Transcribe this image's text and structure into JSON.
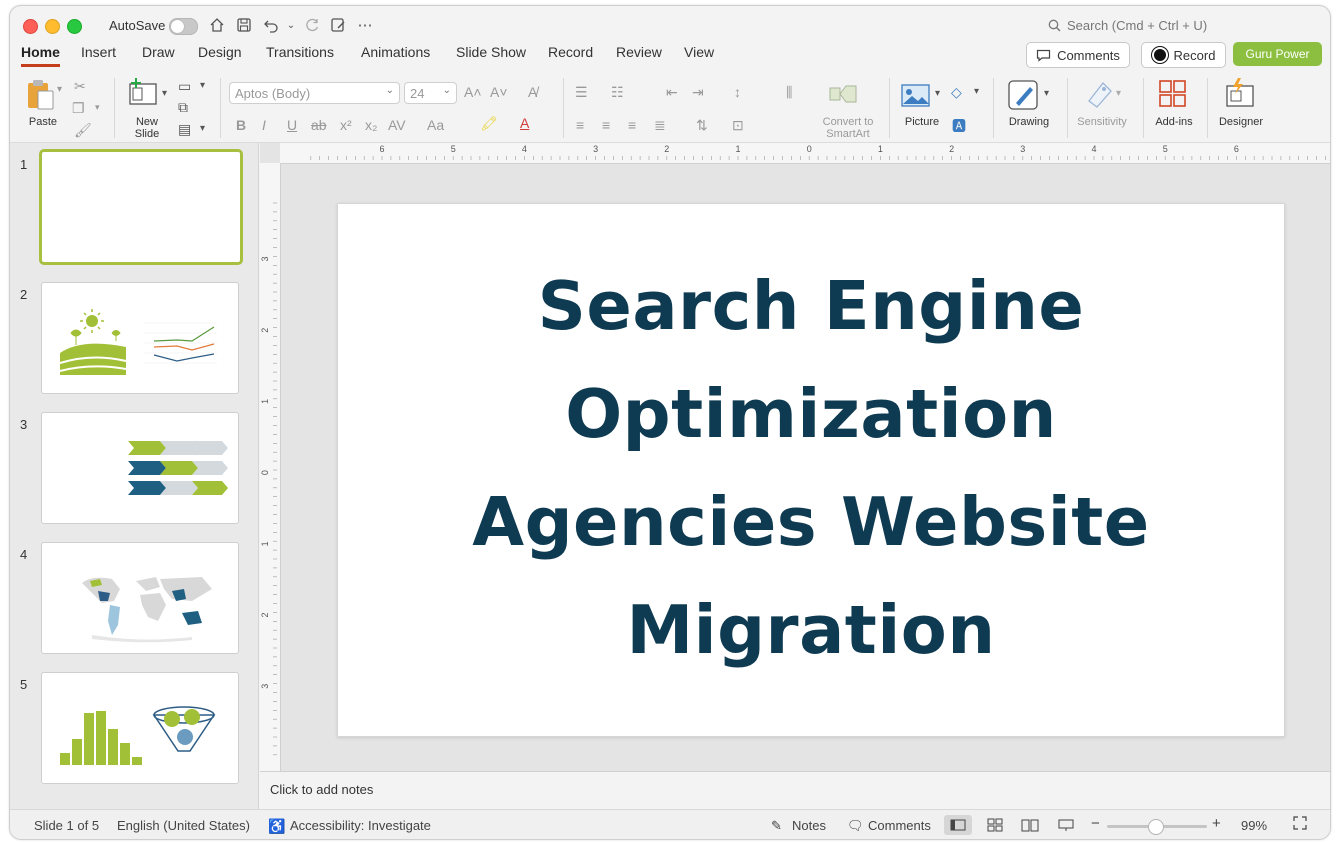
{
  "titlebar": {
    "autosave_label": "AutoSave",
    "search_placeholder": "Search (Cmd + Ctrl + U)"
  },
  "tabs": [
    "Home",
    "Insert",
    "Draw",
    "Design",
    "Transitions",
    "Animations",
    "Slide Show",
    "Record",
    "Review",
    "View"
  ],
  "header_buttons": {
    "comments": "Comments",
    "record": "Record",
    "guru": "Guru Power"
  },
  "ribbon": {
    "paste": "Paste",
    "new_slide_line1": "New",
    "new_slide_line2": "Slide",
    "font_name": "Aptos (Body)",
    "font_size": "24",
    "convert_line1": "Convert to",
    "convert_line2": "SmartArt",
    "picture": "Picture",
    "drawing": "Drawing",
    "sensitivity": "Sensitivity",
    "addins": "Add-ins",
    "designer": "Designer"
  },
  "thumbnails": [
    {
      "num": "1"
    },
    {
      "num": "2"
    },
    {
      "num": "3"
    },
    {
      "num": "4"
    },
    {
      "num": "5"
    }
  ],
  "slide": {
    "title_lines": [
      "Search Engine",
      "Optimization",
      "Agencies Website",
      "Migration"
    ]
  },
  "notes": {
    "placeholder": "Click to add notes"
  },
  "status": {
    "slide_info": "Slide 1 of 5",
    "language": "English (United States)",
    "accessibility": "Accessibility: Investigate",
    "notes": "Notes",
    "comments": "Comments",
    "zoom": "99%"
  },
  "ruler": {
    "h_labels": [
      "6",
      "5",
      "4",
      "3",
      "2",
      "1",
      "0",
      "1",
      "2",
      "3",
      "4",
      "5",
      "6"
    ],
    "v_labels": [
      "3",
      "2",
      "1",
      "0",
      "1",
      "2",
      "3"
    ]
  },
  "colors": {
    "title_color": "#0f3b52",
    "accent_red": "#c43e1c",
    "guru_green": "#8cbf3f",
    "thumb_green": "#a2c037",
    "thumb_blue": "#1f5f82"
  }
}
